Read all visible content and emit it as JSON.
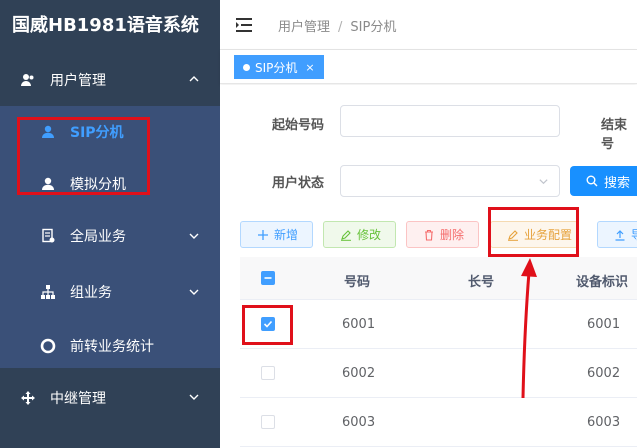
{
  "sidebar": {
    "brand": "国威HB1981语音系统",
    "user_mgmt": "用户管理",
    "sip_ext": "SIP分机",
    "analog_ext": "模拟分机",
    "global_biz": "全局业务",
    "group_biz": "组业务",
    "forward_stats": "前转业务统计",
    "trunk_mgmt": "中继管理"
  },
  "header": {
    "crumb_1": "用户管理",
    "crumb_sep": "/",
    "crumb_2": "SIP分机"
  },
  "tags": {
    "active_tag": "SIP分机",
    "close": "×"
  },
  "filters": {
    "start_label": "起始号码",
    "end_label": "结束号",
    "status_label": "用户状态",
    "search_label": "搜索"
  },
  "toolbar": {
    "add": "新增",
    "edit": "修改",
    "delete": "删除",
    "biz_config": "业务配置",
    "export": "导"
  },
  "table": {
    "headers": [
      "号码",
      "长号",
      "设备标识"
    ],
    "rows": [
      {
        "number": "6001",
        "long": "",
        "device": "6001",
        "checked": true
      },
      {
        "number": "6002",
        "long": "",
        "device": "6002",
        "checked": false
      },
      {
        "number": "6003",
        "long": "",
        "device": "6003",
        "checked": false
      }
    ]
  },
  "colors": {
    "sidebar_bg": "#304156",
    "submenu_bg": "#3a5078",
    "primary": "#409eff",
    "annotation_red": "#e0101a"
  }
}
